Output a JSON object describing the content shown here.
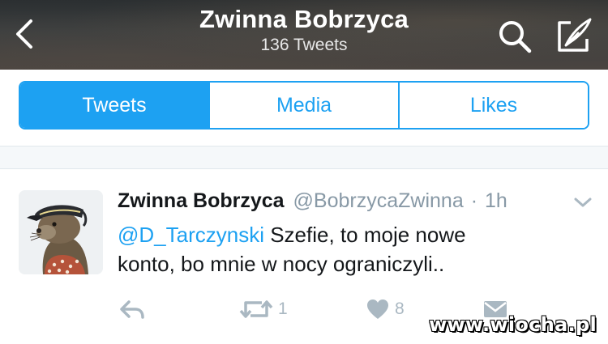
{
  "header": {
    "title": "Zwinna Bobrzyca",
    "subtitle": "136 Tweets"
  },
  "tabs": [
    {
      "label": "Tweets",
      "active": true
    },
    {
      "label": "Media",
      "active": false
    },
    {
      "label": "Likes",
      "active": false
    }
  ],
  "tweet": {
    "display_name": "Zwinna Bobrzyca",
    "handle": "@BobrzycaZwinna",
    "separator": "·",
    "time": "1h",
    "mention": "@D_Tarczynski",
    "text_line1": " Szefie, to moje nowe",
    "text_line2": "konto, bo mnie w nocy ograniczyli..",
    "retweet_count": "1",
    "like_count": "8"
  },
  "watermark": "www.wiocha.pl",
  "colors": {
    "accent": "#1da1f2",
    "text": "#14171a",
    "muted": "#8899a6",
    "icon_muted": "#aab8c2"
  },
  "icons": [
    "back-chevron-icon",
    "search-icon",
    "compose-icon",
    "caret-down-icon",
    "reply-icon",
    "retweet-icon",
    "heart-icon",
    "direct-message-icon"
  ]
}
